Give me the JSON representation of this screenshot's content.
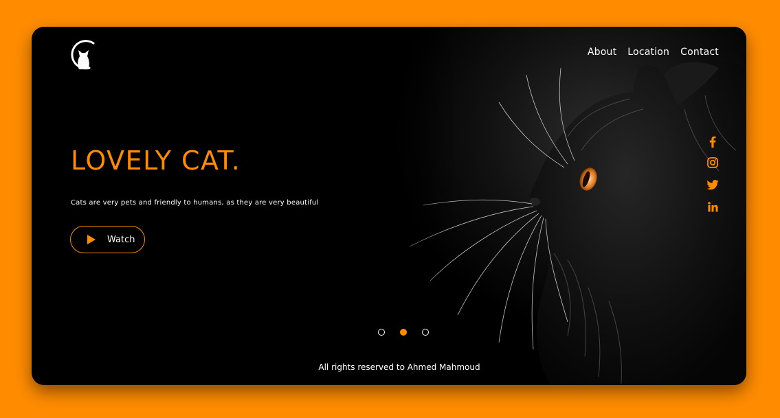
{
  "nav": {
    "items": [
      {
        "label": "About"
      },
      {
        "label": "Location"
      },
      {
        "label": "Contact"
      }
    ]
  },
  "hero": {
    "title": "LOVELY CAT.",
    "subtitle": "Cats are very pets and friendly to humans, as they are very beautiful",
    "watch_label": "Watch"
  },
  "social": {
    "items": [
      {
        "icon": "facebook-icon"
      },
      {
        "icon": "instagram-icon"
      },
      {
        "icon": "twitter-icon"
      },
      {
        "icon": "linkedin-icon"
      }
    ]
  },
  "slider": {
    "dot_count": 3,
    "active_index": 1
  },
  "footer": {
    "text": "All rights reserved to Ahmed Mahmoud"
  },
  "colors": {
    "accent": "#ff8c00",
    "background": "#000000",
    "page_background": "#ff8c00",
    "text": "#ffffff"
  }
}
